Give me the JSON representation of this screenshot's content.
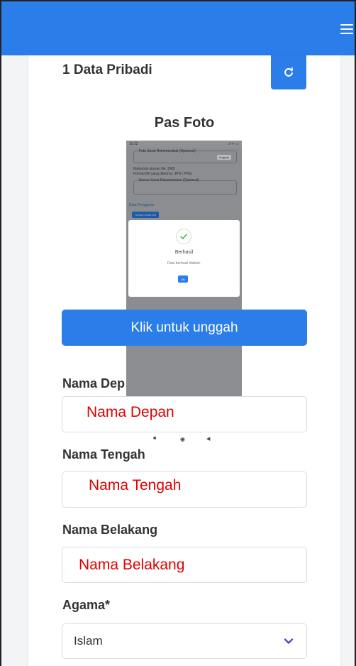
{
  "section": {
    "title": "1 Data Pribadi"
  },
  "photo": {
    "title": "Pas Foto",
    "upload_label": "Klik untuk unggah",
    "preview": {
      "status_time": "10:22",
      "status_icons": ".ıl ᯤ ▭",
      "field1_label": "Foto Surat Rekomendasi (Opsional)",
      "field1_button": "Unggah",
      "hint_line1": "Maksimal ukuran file: 2MB",
      "hint_line2": "Format file yang diterima: JPG / PNG",
      "field2_label": "Nomor Surat Rekomendasi (Opsional)",
      "link": "Data Pengguna",
      "save_button": "Simpan Data Diri",
      "dialog_title": "Berhasil",
      "dialog_message": "Data berhasil diubah.",
      "dialog_ok": "Ok"
    }
  },
  "fields": {
    "first_name": {
      "label": "Nama Dep",
      "value": "Nama Depan"
    },
    "middle_name": {
      "label": "Nama Tengah",
      "value": "Nama Tengah"
    },
    "last_name": {
      "label": "Nama Belakang",
      "value": "Nama Belakang"
    },
    "religion": {
      "label": "Agama*",
      "value": "Islam"
    }
  },
  "colors": {
    "primary": "#2b7de9",
    "annotation": "#e00000",
    "chevron": "#6a3fc9"
  },
  "icons": {
    "menu": "hamburger-icon",
    "refresh": "refresh-icon",
    "select": "chevron-down-icon"
  }
}
